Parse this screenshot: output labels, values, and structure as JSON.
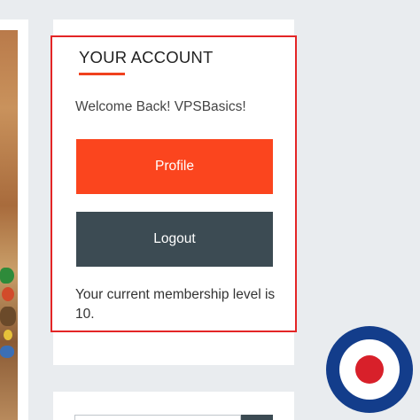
{
  "account_widget": {
    "title": "YOUR ACCOUNT",
    "welcome": "Welcome Back! VPSBasics!",
    "profile_button": "Profile",
    "logout_button": "Logout",
    "membership": "Your current membership level is 10."
  },
  "colors": {
    "accent": "#fb451e",
    "highlight_border": "#e32526",
    "dark_button": "#3c4b53",
    "page_background": "#e9ecef",
    "roundel_blue": "#133d8b",
    "roundel_red": "#d8202a"
  },
  "icons": {
    "roundel": "target-roundel-icon"
  }
}
